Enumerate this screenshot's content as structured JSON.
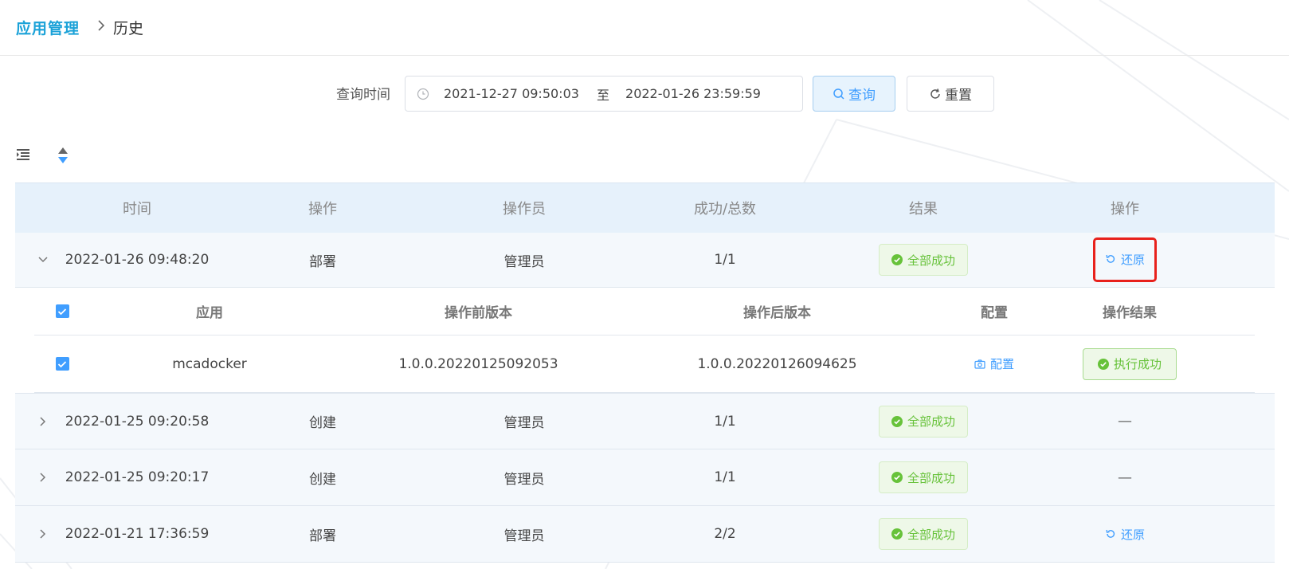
{
  "breadcrumb": {
    "root": "应用管理",
    "separator": ">",
    "current": "历史"
  },
  "query": {
    "label": "查询时间",
    "start": "2021-12-27 09:50:03",
    "separator": "至",
    "end": "2022-01-26 23:59:59",
    "search_label": "查询",
    "reset_label": "重置"
  },
  "table": {
    "headers": {
      "time": "时间",
      "op": "操作",
      "user": "操作员",
      "count": "成功/总数",
      "result": "结果",
      "action": "操作"
    },
    "rows": [
      {
        "time": "2022-01-26 09:48:20",
        "op": "部署",
        "user": "管理员",
        "count": "1/1",
        "result": "全部成功",
        "action": "还原"
      },
      {
        "time": "2022-01-25 09:20:58",
        "op": "创建",
        "user": "管理员",
        "count": "1/1",
        "result": "全部成功",
        "action": "—"
      },
      {
        "time": "2022-01-25 09:20:17",
        "op": "创建",
        "user": "管理员",
        "count": "1/1",
        "result": "全部成功",
        "action": "—"
      },
      {
        "time": "2022-01-21 17:36:59",
        "op": "部署",
        "user": "管理员",
        "count": "2/2",
        "result": "全部成功",
        "action": "还原"
      }
    ],
    "sub": {
      "headers": {
        "app": "应用",
        "pre": "操作前版本",
        "post": "操作后版本",
        "config": "配置",
        "result": "操作结果"
      },
      "rows": [
        {
          "app": "mcadocker",
          "pre": "1.0.0.20220125092053",
          "post": "1.0.0.20220126094625",
          "config": "配置",
          "result": "执行成功"
        }
      ]
    }
  },
  "colors": {
    "accent": "#409eff",
    "brand": "#1ba2d8",
    "success": "#67c23a",
    "highlight": "#e8211c"
  },
  "icons": [
    "clock-icon",
    "search-icon",
    "refresh-icon",
    "list-icon",
    "sort-icon",
    "chevron-down-icon",
    "chevron-right-icon",
    "check-circle-icon",
    "restore-icon",
    "camera-icon",
    "checkbox-checked-icon"
  ]
}
